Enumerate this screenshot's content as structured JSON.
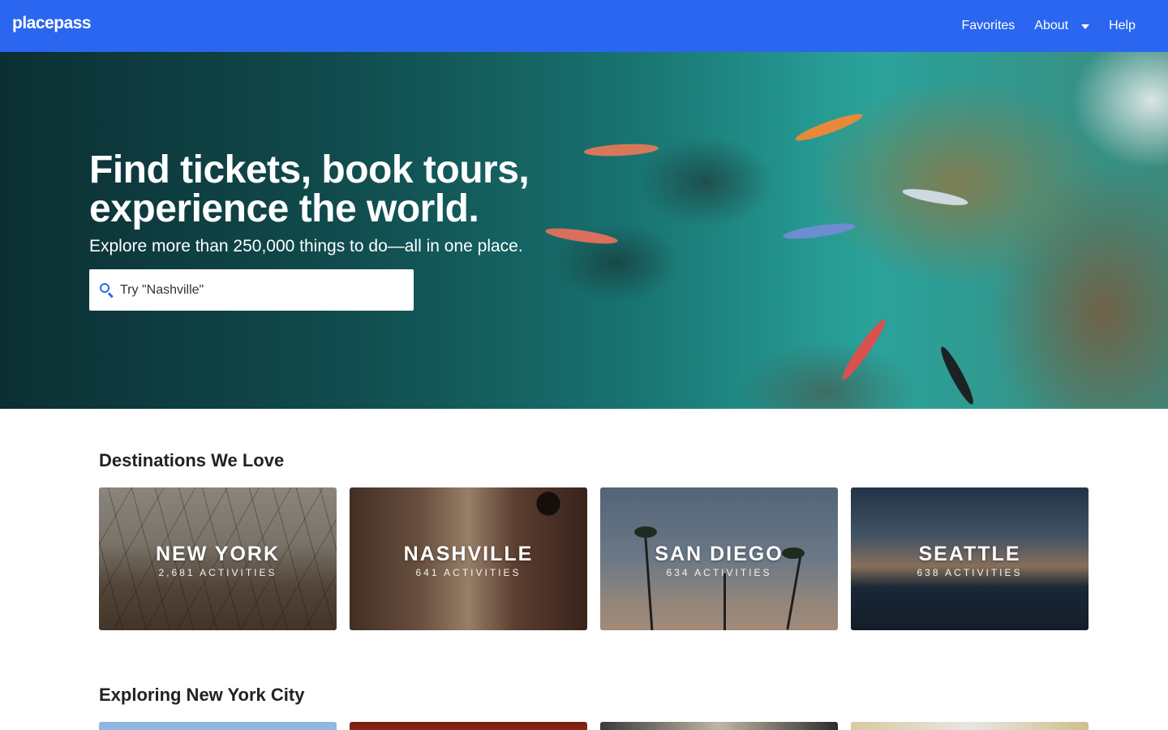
{
  "header": {
    "logo": "placepass",
    "nav": [
      {
        "label": "Favorites"
      },
      {
        "label": "About"
      },
      {
        "label": "Help"
      }
    ]
  },
  "hero": {
    "title_line1": "Find tickets, book tours,",
    "title_line2": "experience the world.",
    "subtitle": "Explore more than 250,000 things to do—all in one place.",
    "search_placeholder": "Try \"Nashville\""
  },
  "destinations": {
    "title": "Destinations We Love",
    "cards": [
      {
        "name": "NEW YORK",
        "count": "2,681 ACTIVITIES"
      },
      {
        "name": "NASHVILLE",
        "count": "641 ACTIVITIES"
      },
      {
        "name": "SAN DIEGO",
        "count": "634 ACTIVITIES"
      },
      {
        "name": "SEATTLE",
        "count": "638 ACTIVITIES"
      }
    ]
  },
  "exploring": {
    "title": "Exploring New York City"
  },
  "colors": {
    "brand": "#2a66f0"
  }
}
